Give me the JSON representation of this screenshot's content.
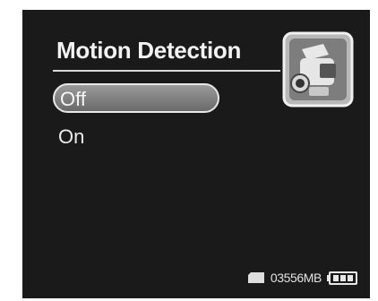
{
  "screen": {
    "title": "Motion Detection",
    "menu": {
      "items": [
        {
          "label": "Off",
          "selected": true
        },
        {
          "label": "On",
          "selected": false
        }
      ]
    },
    "mode_icon": "camcorder-icon",
    "status_bar": {
      "memory_card_icon": "sd-card-icon",
      "remaining_storage": "03556MB",
      "battery_icon": "battery-full-icon"
    }
  },
  "colors": {
    "background": "#1a1a1a",
    "text": "#f2f2f2",
    "highlight": "#8a8a8a"
  }
}
